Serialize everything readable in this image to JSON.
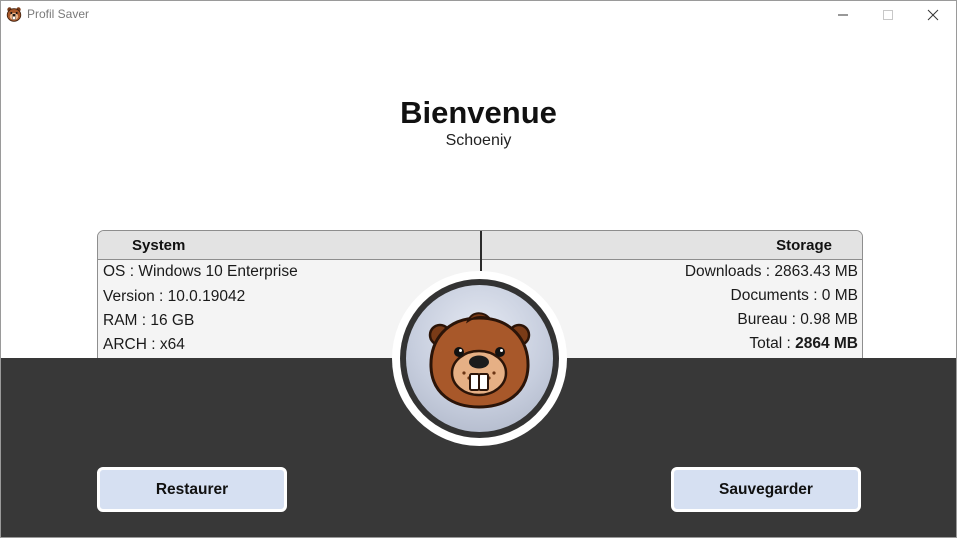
{
  "window": {
    "title": "Profil Saver",
    "icon": "beaver-app-icon",
    "controls": [
      "minimize-icon",
      "maximize-icon",
      "close-icon"
    ]
  },
  "header": {
    "welcome": "Bienvenue",
    "username": "Schoeniy"
  },
  "panel": {
    "system_header": "System",
    "storage_header": "Storage",
    "system_rows": [
      "OS : Windows 10 Enterprise",
      "Version : 10.0.19042",
      "RAM : 16 GB",
      "ARCH : x64"
    ],
    "storage_rows": [
      "Downloads : 2863.43 MB",
      "Documents : 0 MB",
      "Bureau : 0.98 MB"
    ],
    "total": {
      "label": "Total : ",
      "value": "2864 MB"
    }
  },
  "logo": {
    "icon": "beaver-logo-icon"
  },
  "buttons": {
    "restore_label": "Restaurer",
    "save_label": "Sauvegarder"
  },
  "colors": {
    "dark_background": "#383838",
    "button_background": "#d6e0f2",
    "panel_background": "#f4f4f4",
    "panel_header": "#e3e3e3",
    "beaver_fur": "#a8582a"
  }
}
